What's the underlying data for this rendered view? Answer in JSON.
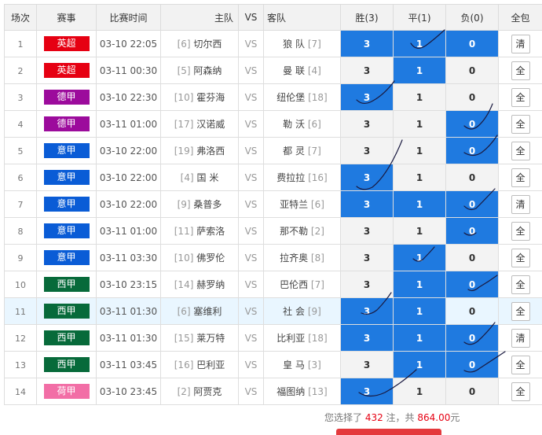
{
  "headers": {
    "index": "场次",
    "league": "赛事",
    "time": "比赛时间",
    "home": "主队",
    "vs": "VS",
    "away": "客队",
    "win": "胜(3)",
    "draw": "平(1)",
    "lose": "负(0)",
    "all": "全包"
  },
  "colors": {
    "英超": "#e60012",
    "德甲": "#9c0b9c",
    "意甲": "#0a5cd6",
    "西甲": "#076a3a",
    "荷甲": "#f26ea6",
    "selected": "#1f7ae0"
  },
  "matches": [
    {
      "no": "1",
      "league": "英超",
      "time": "03-10 22:05",
      "home_rank": "[6]",
      "home": "切尔西",
      "vs": "VS",
      "away": "狼 队",
      "away_rank": "[7]",
      "win": "3",
      "draw": "1",
      "lose": "0",
      "all": "清",
      "sel": [
        true,
        true,
        true
      ],
      "hl": false
    },
    {
      "no": "2",
      "league": "英超",
      "time": "03-11 00:30",
      "home_rank": "[5]",
      "home": "阿森纳",
      "vs": "VS",
      "away": "曼 联",
      "away_rank": "[4]",
      "win": "3",
      "draw": "1",
      "lose": "0",
      "all": "全",
      "sel": [
        false,
        true,
        false
      ],
      "hl": false
    },
    {
      "no": "3",
      "league": "德甲",
      "time": "03-10 22:30",
      "home_rank": "[10]",
      "home": "霍芬海",
      "vs": "VS",
      "away": "纽伦堡",
      "away_rank": "[18]",
      "win": "3",
      "draw": "1",
      "lose": "0",
      "all": "全",
      "sel": [
        true,
        false,
        false
      ],
      "hl": false
    },
    {
      "no": "4",
      "league": "德甲",
      "time": "03-11 01:00",
      "home_rank": "[17]",
      "home": "汉诺威",
      "vs": "VS",
      "away": "勒 沃",
      "away_rank": "[6]",
      "win": "3",
      "draw": "1",
      "lose": "0",
      "all": "全",
      "sel": [
        false,
        false,
        true
      ],
      "hl": false
    },
    {
      "no": "5",
      "league": "意甲",
      "time": "03-10 22:00",
      "home_rank": "[19]",
      "home": "弗洛西",
      "vs": "VS",
      "away": "都 灵",
      "away_rank": "[7]",
      "win": "3",
      "draw": "1",
      "lose": "0",
      "all": "全",
      "sel": [
        false,
        false,
        true
      ],
      "hl": false
    },
    {
      "no": "6",
      "league": "意甲",
      "time": "03-10 22:00",
      "home_rank": "[4]",
      "home": "国 米",
      "vs": "VS",
      "away": "费拉拉",
      "away_rank": "[16]",
      "win": "3",
      "draw": "1",
      "lose": "0",
      "all": "全",
      "sel": [
        true,
        false,
        false
      ],
      "hl": false
    },
    {
      "no": "7",
      "league": "意甲",
      "time": "03-10 22:00",
      "home_rank": "[9]",
      "home": "桑普多",
      "vs": "VS",
      "away": "亚特兰",
      "away_rank": "[6]",
      "win": "3",
      "draw": "1",
      "lose": "0",
      "all": "清",
      "sel": [
        true,
        true,
        true
      ],
      "hl": false
    },
    {
      "no": "8",
      "league": "意甲",
      "time": "03-11 01:00",
      "home_rank": "[11]",
      "home": "萨索洛",
      "vs": "VS",
      "away": "那不勒",
      "away_rank": "[2]",
      "win": "3",
      "draw": "1",
      "lose": "0",
      "all": "全",
      "sel": [
        false,
        false,
        true
      ],
      "hl": false
    },
    {
      "no": "9",
      "league": "意甲",
      "time": "03-11 03:30",
      "home_rank": "[10]",
      "home": "佛罗伦",
      "vs": "VS",
      "away": "拉齐奥",
      "away_rank": "[8]",
      "win": "3",
      "draw": "1",
      "lose": "0",
      "all": "全",
      "sel": [
        false,
        true,
        false
      ],
      "hl": false
    },
    {
      "no": "10",
      "league": "西甲",
      "time": "03-10 23:15",
      "home_rank": "[14]",
      "home": "赫罗纳",
      "vs": "VS",
      "away": "巴伦西",
      "away_rank": "[7]",
      "win": "3",
      "draw": "1",
      "lose": "0",
      "all": "全",
      "sel": [
        false,
        true,
        true
      ],
      "hl": false
    },
    {
      "no": "11",
      "league": "西甲",
      "time": "03-11 01:30",
      "home_rank": "[6]",
      "home": "塞维利",
      "vs": "VS",
      "away": "社 会",
      "away_rank": "[9]",
      "win": "3",
      "draw": "1",
      "lose": "0",
      "all": "全",
      "sel": [
        true,
        true,
        false
      ],
      "hl": true
    },
    {
      "no": "12",
      "league": "西甲",
      "time": "03-11 01:30",
      "home_rank": "[15]",
      "home": "莱万特",
      "vs": "VS",
      "away": "比利亚",
      "away_rank": "[18]",
      "win": "3",
      "draw": "1",
      "lose": "0",
      "all": "清",
      "sel": [
        true,
        true,
        true
      ],
      "hl": false
    },
    {
      "no": "13",
      "league": "西甲",
      "time": "03-11 03:45",
      "home_rank": "[16]",
      "home": "巴利亚",
      "vs": "VS",
      "away": "皇 马",
      "away_rank": "[3]",
      "win": "3",
      "draw": "1",
      "lose": "0",
      "all": "全",
      "sel": [
        false,
        true,
        true
      ],
      "hl": false
    },
    {
      "no": "14",
      "league": "荷甲",
      "time": "03-10 23:45",
      "home_rank": "[2]",
      "home": "阿贾克",
      "vs": "VS",
      "away": "福图纳",
      "away_rank": "[13]",
      "win": "3",
      "draw": "1",
      "lose": "0",
      "all": "全",
      "sel": [
        true,
        false,
        false
      ],
      "hl": false
    }
  ],
  "summary": {
    "prefix": "您选择了 ",
    "count": "432",
    "mid": " 注，共 ",
    "amount": "864.00",
    "suffix": "元"
  }
}
